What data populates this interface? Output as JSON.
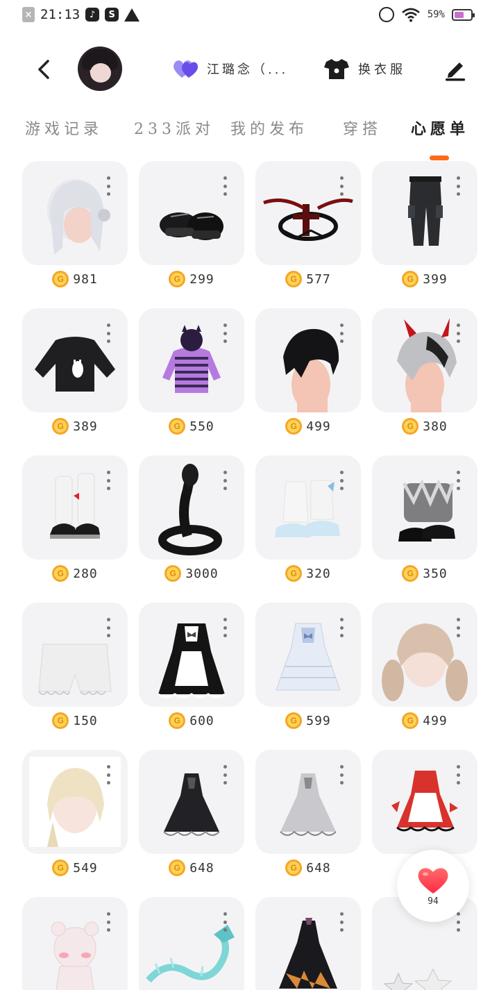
{
  "status_bar": {
    "time": "21:13",
    "battery_text": "59%",
    "battery_level": 0.59,
    "icons": [
      "close-notification-icon",
      "tiktok-icon",
      "s-app-icon",
      "warning-icon",
      "alarm-icon",
      "wifi-icon",
      "battery-icon"
    ]
  },
  "header": {
    "back_icon": "chevron-left-icon",
    "relation_label": "江璐念（...",
    "relation_icon": "double-heart-icon",
    "wardrobe_label": "换衣服",
    "wardrobe_icon": "tshirt-icon",
    "edit_icon": "edit-pen-icon"
  },
  "tabs": [
    {
      "label": "游戏记录",
      "active": false
    },
    {
      "label": "233派对",
      "active": false
    },
    {
      "label": "我的发布",
      "active": false
    },
    {
      "label": "穿搭",
      "active": false
    },
    {
      "label": "心愿单",
      "active": true
    }
  ],
  "colors": {
    "accent": "#ff6a1a",
    "coin": "#f5a623",
    "heart": "#ff3b4a",
    "card_bg": "#f3f3f5"
  },
  "currency_icon": "g-coin-icon",
  "items": [
    {
      "art": "white-hair",
      "price": "981"
    },
    {
      "art": "black-shoes",
      "price": "299"
    },
    {
      "art": "gothic-halo",
      "price": "577"
    },
    {
      "art": "black-pants",
      "price": "399"
    },
    {
      "art": "black-sweater",
      "price": "389"
    },
    {
      "art": "purple-hoodie",
      "price": "550"
    },
    {
      "art": "black-hair",
      "price": "499"
    },
    {
      "art": "horned-hair",
      "price": "380"
    },
    {
      "art": "bow-socks-shoes",
      "price": "280"
    },
    {
      "art": "cobra",
      "price": "3000"
    },
    {
      "art": "fluffy-boots",
      "price": "320"
    },
    {
      "art": "fur-black-shoes",
      "price": "350"
    },
    {
      "art": "white-shorts",
      "price": "150"
    },
    {
      "art": "maid-dress",
      "price": "600"
    },
    {
      "art": "lolita-dress",
      "price": "599"
    },
    {
      "art": "twin-tail-hair",
      "price": "499"
    },
    {
      "art": "braided-blonde-hair",
      "price": "549"
    },
    {
      "art": "black-gothic-dress",
      "price": "648"
    },
    {
      "art": "white-gothic-dress",
      "price": "648"
    },
    {
      "art": "red-maid-outfit",
      "price": ""
    },
    {
      "art": "bear-costume",
      "price": ""
    },
    {
      "art": "ice-dragon",
      "price": ""
    },
    {
      "art": "dark-orange-dress",
      "price": ""
    },
    {
      "art": "star-items",
      "price": ""
    }
  ],
  "like_button": {
    "icon": "heart-icon",
    "count": "94"
  }
}
